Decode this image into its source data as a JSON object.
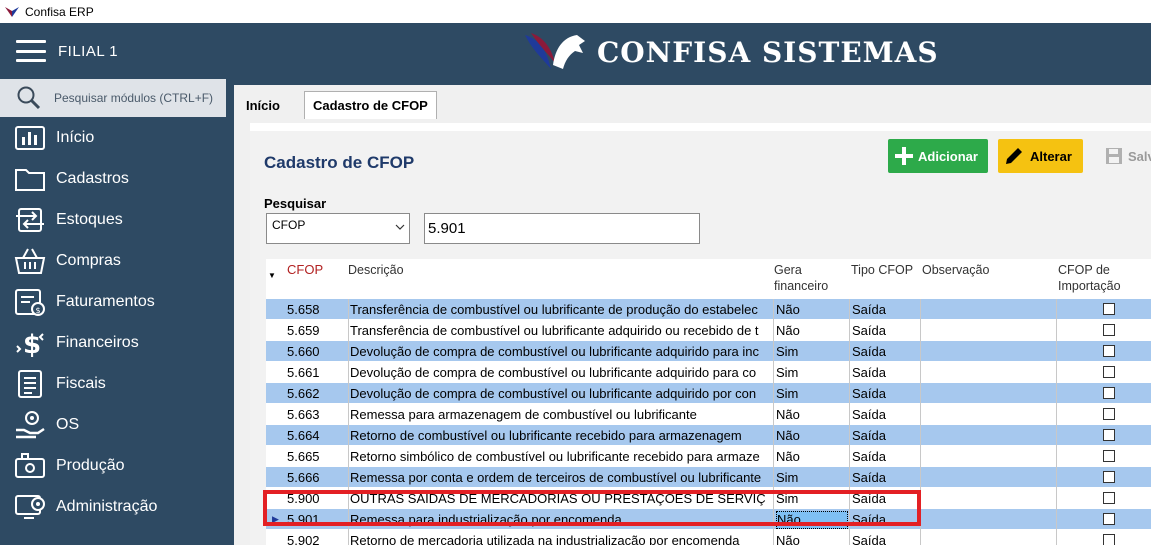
{
  "window": {
    "title": "Confisa ERP"
  },
  "sidebar": {
    "filial": "FILIAL 1",
    "search_placeholder": "Pesquisar módulos (CTRL+F)",
    "items": [
      {
        "label": "Início",
        "icon": "chart-icon"
      },
      {
        "label": "Cadastros",
        "icon": "folder-icon"
      },
      {
        "label": "Estoques",
        "icon": "transfer-icon"
      },
      {
        "label": "Compras",
        "icon": "basket-icon"
      },
      {
        "label": "Faturamentos",
        "icon": "invoice-icon"
      },
      {
        "label": "Financeiros",
        "icon": "dollar-icon"
      },
      {
        "label": "Fiscais",
        "icon": "list-icon"
      },
      {
        "label": "OS",
        "icon": "service-icon"
      },
      {
        "label": "Produção",
        "icon": "production-icon"
      },
      {
        "label": "Administração",
        "icon": "admin-icon"
      }
    ]
  },
  "banner": {
    "brand": "CONFISA SISTEMAS"
  },
  "tabs": [
    {
      "label": "Início"
    },
    {
      "label": "Cadastro de CFOP"
    }
  ],
  "page": {
    "title": "Cadastro de CFOP",
    "buttons": {
      "add": "Adicionar",
      "edit": "Alterar",
      "save": "Salv"
    },
    "search_label": "Pesquisar",
    "search_field": "CFOP",
    "search_value": "5.901"
  },
  "grid": {
    "headers": {
      "cfop": "CFOP",
      "descricao": "Descrição",
      "gera": "Gera financeiro",
      "tipo": "Tipo CFOP",
      "obs": "Observação",
      "importacao": "CFOP de Importação"
    },
    "rows": [
      {
        "cfop": "5.658",
        "descricao": "Transferência de combustível ou lubrificante de produção do estabelec",
        "gera": "Não",
        "tipo": "Saída"
      },
      {
        "cfop": "5.659",
        "descricao": "Transferência de combustível ou lubrificante adquirido ou recebido de t",
        "gera": "Não",
        "tipo": "Saída"
      },
      {
        "cfop": "5.660",
        "descricao": "Devolução de compra de combustível ou lubrificante adquirido para inc",
        "gera": "Sim",
        "tipo": "Saída"
      },
      {
        "cfop": "5.661",
        "descricao": "Devolução de compra de combustível ou lubrificante adquirido para co",
        "gera": "Sim",
        "tipo": "Saída"
      },
      {
        "cfop": "5.662",
        "descricao": "Devolução de compra de combustível ou lubrificante adquirido por con",
        "gera": "Sim",
        "tipo": "Saída"
      },
      {
        "cfop": "5.663",
        "descricao": "Remessa para armazenagem de combustível ou lubrificante",
        "gera": "Não",
        "tipo": "Saída"
      },
      {
        "cfop": "5.664",
        "descricao": "Retorno de combustível ou lubrificante recebido para armazenagem",
        "gera": "Não",
        "tipo": "Saída"
      },
      {
        "cfop": "5.665",
        "descricao": "Retorno simbólico de combustível ou lubrificante recebido para armaze",
        "gera": "Não",
        "tipo": "Saída"
      },
      {
        "cfop": "5.666",
        "descricao": "Remessa por conta e ordem de terceiros de combustível ou lubrificante",
        "gera": "Sim",
        "tipo": "Saída"
      },
      {
        "cfop": "5.900",
        "descricao": "OUTRAS SAÍDAS DE MERCADORIAS OU PRESTAÇÕES DE SERVIÇ",
        "gera": "Sim",
        "tipo": "Saída"
      },
      {
        "cfop": "5.901",
        "descricao": "Remessa para industrialização por encomenda",
        "gera": "Não",
        "tipo": "Saída"
      },
      {
        "cfop": "5.902",
        "descricao": "Retorno de mercadoria utilizada na industrialização por encomenda",
        "gera": "Não",
        "tipo": "Saída"
      }
    ]
  },
  "colors": {
    "sidebar": "#2e4a63",
    "row_alt": "#a6c8ee",
    "add": "#2daa4a",
    "edit": "#f5c211",
    "highlight": "#e32024"
  }
}
